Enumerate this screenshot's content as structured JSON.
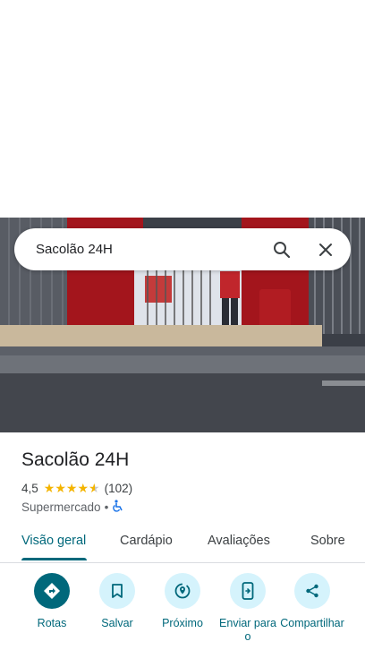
{
  "search": {
    "query": "Sacolão 24H"
  },
  "place": {
    "name": "Sacolão 24H",
    "rating": "4,5",
    "rating_value": 4.5,
    "rating_max": 5,
    "reviews": "(102)",
    "category": "Supermercado",
    "separator": "•",
    "accessibility_icon": "wheelchair-icon"
  },
  "tabs": [
    {
      "label": "Visão geral",
      "active": true
    },
    {
      "label": "Cardápio",
      "active": false
    },
    {
      "label": "Avaliações",
      "active": false
    },
    {
      "label": "Sobre",
      "active": false
    }
  ],
  "actions": [
    {
      "label": "Rotas",
      "icon": "directions-icon"
    },
    {
      "label": "Salvar",
      "icon": "bookmark-icon"
    },
    {
      "label": "Próximo",
      "icon": "nearby-icon"
    },
    {
      "label": "Enviar para o",
      "icon": "send-to-phone-icon"
    },
    {
      "label": "Compartilhar",
      "icon": "share-icon"
    }
  ],
  "colors": {
    "accent": "#00687b",
    "action_bg": "#d5f3fc",
    "star": "#f4b400"
  }
}
